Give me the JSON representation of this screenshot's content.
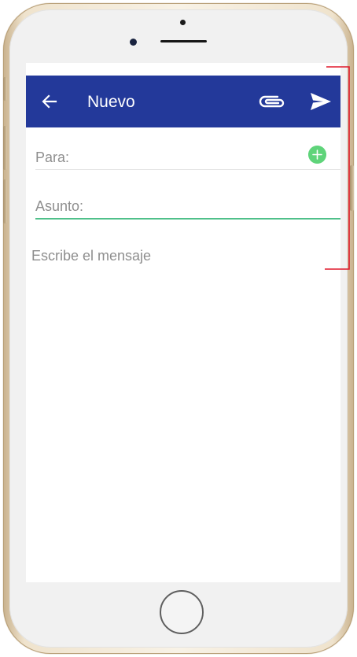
{
  "app_bar": {
    "title": "Nuevo",
    "background_color": "#23399a",
    "back_icon": "arrow-left-icon",
    "attach_icon": "paperclip-icon",
    "send_icon": "send-icon"
  },
  "form": {
    "to_label": "Para:",
    "add_recipient_icon": "plus-circle-icon",
    "subject_label": "Asunto:",
    "message_placeholder": "Escribe el mensaje",
    "active_underline_color": "#4fc08a",
    "add_button_color": "#5fd47a"
  },
  "annotation": {
    "bracket_color": "#e0192b"
  }
}
